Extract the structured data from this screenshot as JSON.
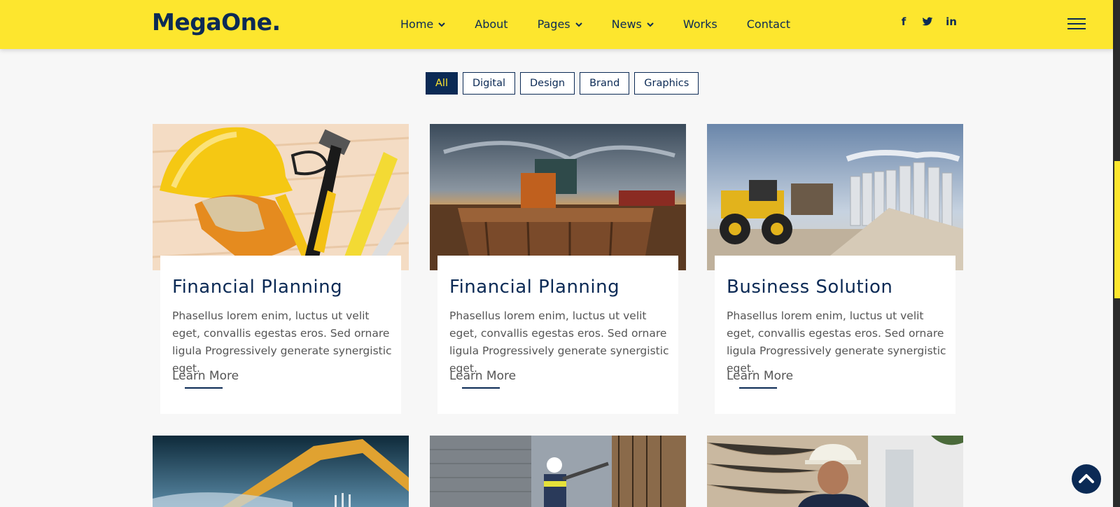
{
  "header": {
    "logo": "MegaOne.",
    "nav": [
      {
        "label": "Home",
        "dropdown": true
      },
      {
        "label": "About",
        "dropdown": false
      },
      {
        "label": "Pages",
        "dropdown": true
      },
      {
        "label": "News",
        "dropdown": true
      },
      {
        "label": "Works",
        "dropdown": false
      },
      {
        "label": "Contact",
        "dropdown": false
      }
    ],
    "social": [
      "f",
      "twitter-icon",
      "in"
    ]
  },
  "filters": [
    "All",
    "Digital",
    "Design",
    "Brand",
    "Graphics"
  ],
  "cards": [
    {
      "title": "Financial Planning",
      "text": "Phasellus lorem enim, luctus ut velit eget, convallis egestas eros. Sed ornare ligula Progressively generate synergistic eget.",
      "link": "Learn More"
    },
    {
      "title": "Financial Planning",
      "text": "Phasellus lorem enim, luctus ut velit eget, convallis egestas eros. Sed ornare ligula Progressively generate synergistic eget.",
      "link": "Learn More"
    },
    {
      "title": "Business Solution",
      "text": "Phasellus lorem enim, luctus ut velit eget, convallis egestas eros. Sed ornare ligula Progressively generate synergistic eget.",
      "link": "Learn More"
    }
  ],
  "colors": {
    "accent": "#fde62e",
    "navy": "#0b2a55"
  }
}
